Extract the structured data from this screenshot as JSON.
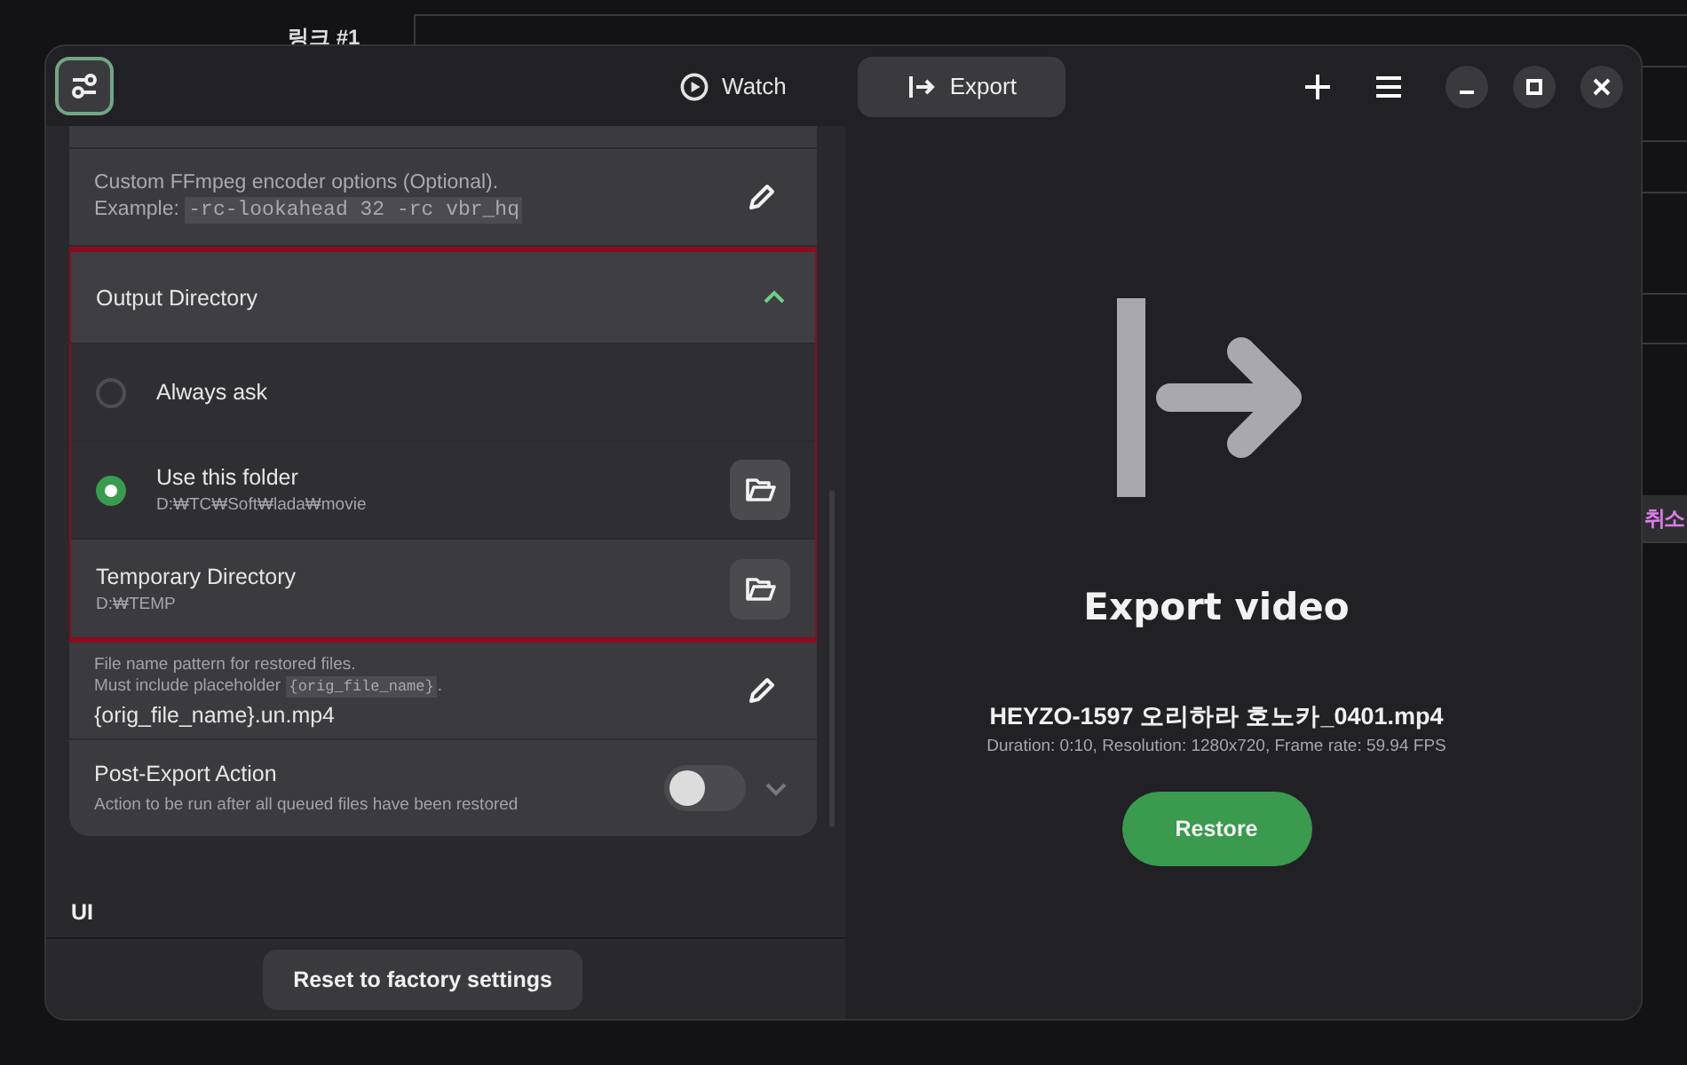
{
  "background": {
    "heading": "링크 #1",
    "cancel_button": "취소"
  },
  "header": {
    "tabs": [
      {
        "label": "Watch",
        "selected": false
      },
      {
        "label": "Export",
        "selected": true
      }
    ]
  },
  "settings": {
    "rows": [
      {
        "kind": "edit",
        "highlighted": false,
        "lines": [
          {
            "text": "Custom FFmpeg encoder options (Optional)."
          },
          {
            "text": "Example:",
            "code": "-rc-lookahead 32 -rc vbr_hq"
          }
        ]
      },
      {
        "kind": "group",
        "highlighted": true,
        "title": "Output Directory",
        "expanded": true,
        "options": [
          {
            "label": "Always ask",
            "selected": false
          },
          {
            "label": "Use this folder",
            "path": "D:₩TC₩Soft₩lada₩movie",
            "selected": true
          }
        ]
      },
      {
        "kind": "folder",
        "highlighted": true,
        "title": "Temporary Directory",
        "path": "D:₩TEMP"
      },
      {
        "kind": "edit",
        "highlighted": false,
        "lines": [
          {
            "text": "File name pattern for restored files."
          },
          {
            "text": "Must include placeholder",
            "code": "{orig_file_name}",
            "after": "."
          }
        ],
        "value": "{orig_file_name}.un.mp4"
      },
      {
        "kind": "toggle",
        "highlighted": false,
        "title": "Post-Export Action",
        "description": "Action to be run after all queued files have been restored",
        "on": false,
        "expanded": false
      }
    ],
    "section_heading": "UI",
    "reset_button": "Reset to factory settings"
  },
  "export": {
    "title": "Export video",
    "file_name": "HEYZO-1597 오리하라 호노카_0401.mp4",
    "details": "Duration: 0:10, Resolution: 1280x720, Frame rate: 59.94 FPS",
    "button": "Restore"
  }
}
